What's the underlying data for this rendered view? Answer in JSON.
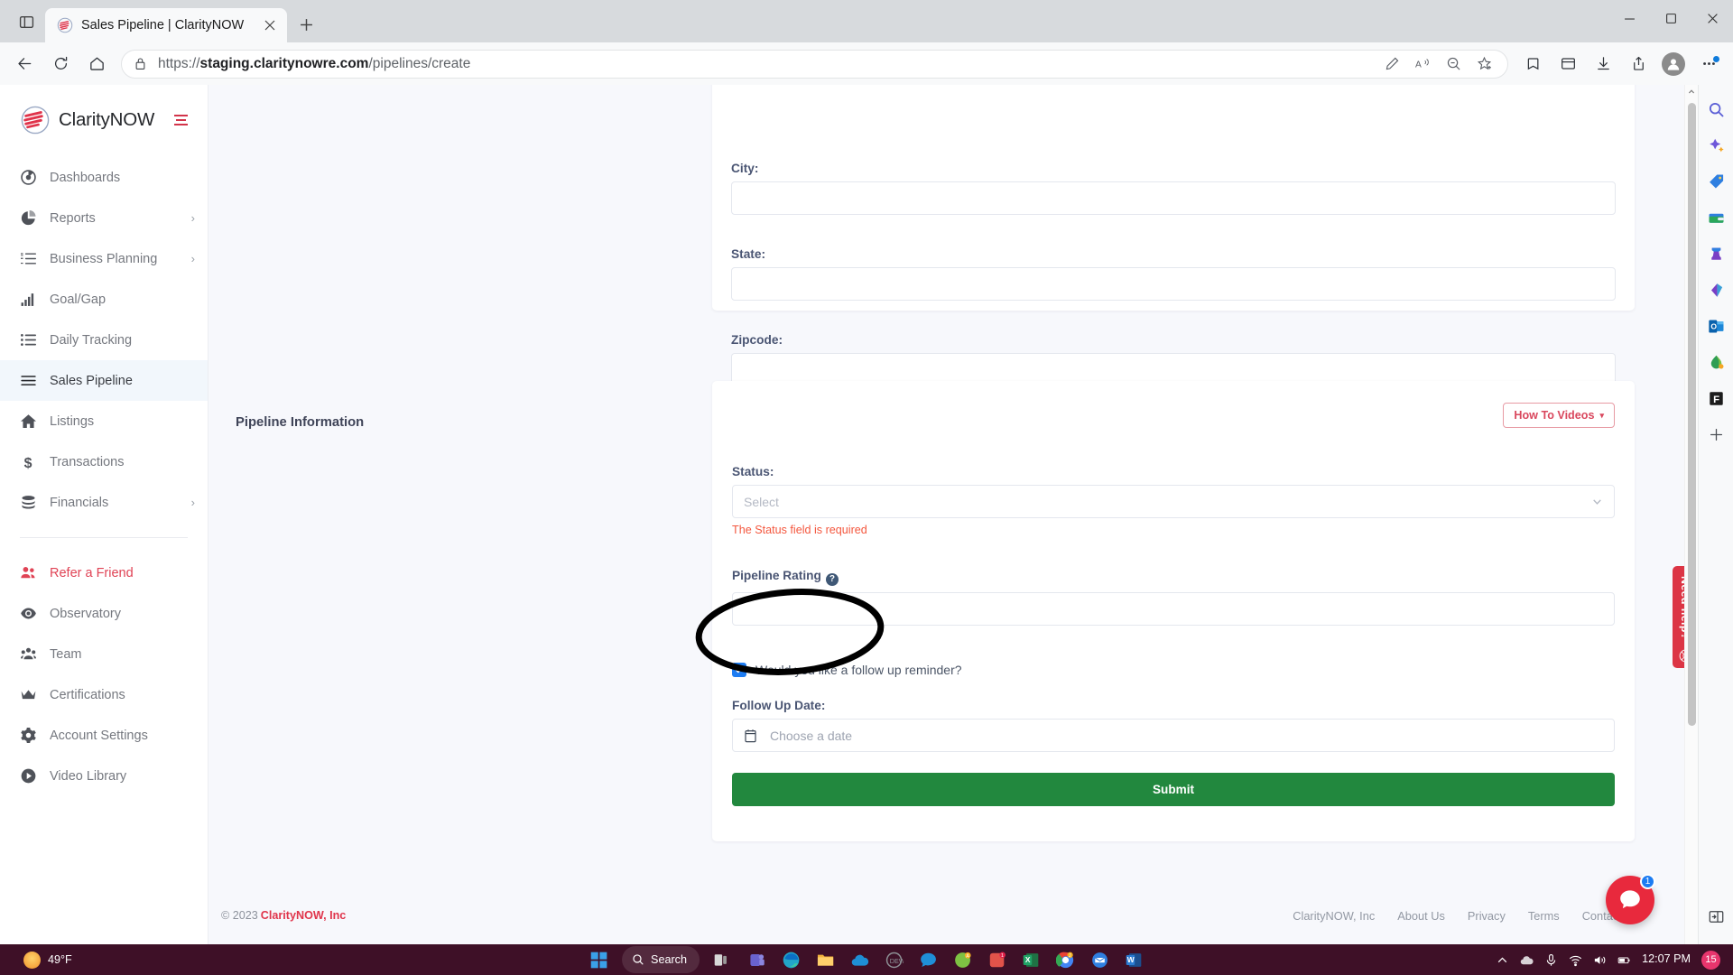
{
  "browser": {
    "tab": {
      "title": "Sales Pipeline | ClarityNOW",
      "favicon": "claritynow-logo-icon",
      "close": "×"
    },
    "new_tab_label": "+",
    "url_prefix": "https://",
    "url_domain": "staging.claritynowre.com",
    "url_path": "/pipelines/create",
    "window_controls": {
      "minimize": "minimize-icon",
      "maximize": "maximize-icon",
      "close": "close-icon"
    },
    "nav": {
      "back": "back-arrow-icon",
      "refresh": "refresh-icon",
      "home": "home-icon"
    },
    "omni_actions": [
      "pen-edit-icon",
      "read-aloud-icon",
      "zoom-out-icon",
      "favorites-add-icon"
    ],
    "toolbar_right": [
      "collections-icon",
      "browser-essentials-icon",
      "downloads-icon",
      "share-icon",
      "profile-icon",
      "settings-more-icon"
    ]
  },
  "sidebar": {
    "brand": "ClarityNOW",
    "menu_toggle": "hamburger-icon",
    "items": [
      {
        "label": "Dashboards",
        "icon": "dashboard-icon",
        "chevron": "",
        "state": "default"
      },
      {
        "label": "Reports",
        "icon": "pie-chart-icon",
        "chevron": "›",
        "state": "default"
      },
      {
        "label": "Business Planning",
        "icon": "task-list-icon",
        "chevron": "›",
        "state": "default"
      },
      {
        "label": "Goal/Gap",
        "icon": "bar-chart-icon",
        "chevron": "",
        "state": "default"
      },
      {
        "label": "Daily Tracking",
        "icon": "list-icon",
        "chevron": "",
        "state": "default"
      },
      {
        "label": "Sales Pipeline",
        "icon": "menu-lines-icon",
        "chevron": "",
        "state": "active"
      },
      {
        "label": "Listings",
        "icon": "home-icon",
        "chevron": "",
        "state": "default"
      },
      {
        "label": "Transactions",
        "icon": "dollar-icon",
        "chevron": "",
        "state": "default"
      },
      {
        "label": "Financials",
        "icon": "coins-icon",
        "chevron": "›",
        "state": "default"
      }
    ],
    "items2": [
      {
        "label": "Refer a Friend",
        "icon": "users-icon",
        "chevron": "",
        "state": "accent"
      },
      {
        "label": "Observatory",
        "icon": "eye-icon",
        "chevron": "",
        "state": "default"
      },
      {
        "label": "Team",
        "icon": "team-icon",
        "chevron": "",
        "state": "default"
      },
      {
        "label": "Certifications",
        "icon": "crown-icon",
        "chevron": "",
        "state": "default"
      },
      {
        "label": "Account Settings",
        "icon": "gear-icon",
        "chevron": "",
        "state": "default"
      },
      {
        "label": "Video Library",
        "icon": "play-circle-icon",
        "chevron": "",
        "state": "default"
      }
    ]
  },
  "address_card": {
    "fields": [
      {
        "label": "City:",
        "value": "",
        "placeholder": ""
      },
      {
        "label": "State:",
        "value": "",
        "placeholder": ""
      },
      {
        "label": "Zipcode:",
        "value": "",
        "placeholder": ""
      }
    ]
  },
  "pipeline_section": {
    "title": "Pipeline Information",
    "how_to_videos": {
      "label": "How To Videos",
      "caret": "▾"
    },
    "status": {
      "label": "Status:",
      "selected": "Select",
      "error": "The Status field is required"
    },
    "rating": {
      "label": "Pipeline Rating",
      "help_glyph": "?",
      "value": ""
    },
    "reminder": {
      "checked": true,
      "check_glyph": "✓",
      "label": "Would you like a follow up reminder?"
    },
    "follow_up": {
      "label": "Follow Up Date:",
      "placeholder": "Choose a date",
      "icon": "calendar-icon"
    },
    "submit_label": "Submit"
  },
  "need_help": {
    "label": "Need help?",
    "icon": "lifebuoy-icon"
  },
  "chat": {
    "icon": "chat-bubble-icon",
    "badge": "1"
  },
  "footer": {
    "copyright": "© 2023",
    "company": "ClarityNOW, Inc",
    "links": [
      "ClarityNOW, Inc",
      "About Us",
      "Privacy",
      "Terms",
      "Contact Us"
    ]
  },
  "edge_rail": {
    "icons": [
      "search-icon",
      "copilot-icon",
      "shopping-tag-icon",
      "wallet-icon",
      "games-icon",
      "microsoft365-icon",
      "outlook-icon",
      "drop-icon",
      "facebook-icon",
      "add-tool-icon"
    ],
    "bottom_icons": [
      "split-screen-icon",
      "settings-gear-icon"
    ]
  },
  "taskbar": {
    "weather": "49°F",
    "weather_icon": "sun-icon",
    "start": "windows-start-icon",
    "search_label": "Search",
    "search_icon": "search-circle-icon",
    "apps": [
      "task-view-icon",
      "teams-icon",
      "edge-icon",
      "file-explorer-icon",
      "onedrive-icon",
      "dell-icon",
      "chat-icon",
      "app-green-icon",
      "app-red-icon",
      "excel-icon",
      "chrome-icon",
      "mail-icon",
      "word-icon"
    ],
    "tray": [
      "show-hidden-icon",
      "cloud-icon",
      "mic-icon",
      "wifi-icon",
      "volume-icon",
      "battery-icon"
    ],
    "clock_time": "12:07 PM",
    "notification_count": "15"
  },
  "colors": {
    "accent_red": "#e0344b",
    "submit_green": "#22883e",
    "error_orange": "#f4573e",
    "checkbox_blue": "#1d7cf2",
    "active_bg": "#f2f7fc",
    "taskbar": "#3e1027"
  }
}
